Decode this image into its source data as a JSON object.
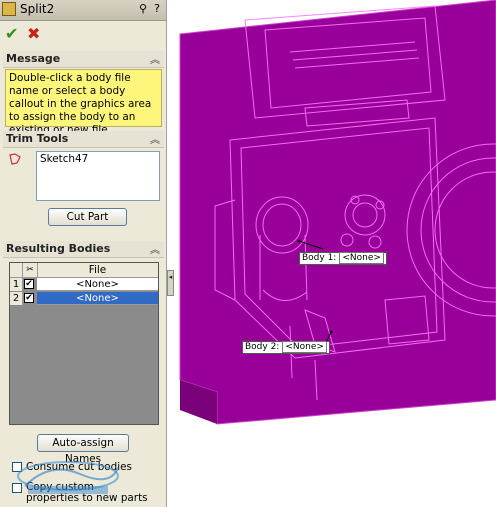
{
  "panel": {
    "title": "Split2",
    "help_icons": [
      "pushpin-icon",
      "help-icon"
    ],
    "actions": {
      "ok": "✔",
      "cancel": "✖"
    },
    "message": {
      "header": "Message",
      "text": "Double-click a body file name or select a body callout in the graphics area to assign the body to an existing or new file."
    },
    "trim_tools": {
      "header": "Trim Tools",
      "items": [
        "Sketch47"
      ],
      "button": "Cut Part"
    },
    "resulting_bodies": {
      "header": "Resulting Bodies",
      "column_file": "File",
      "rows": [
        {
          "num": "1",
          "checked": true,
          "file": "<None>",
          "selected": false
        },
        {
          "num": "2",
          "checked": true,
          "file": "<None>",
          "selected": true
        }
      ],
      "button": "Auto-assign Names",
      "options": [
        "Consume cut bodies",
        "Copy custom properties to new parts"
      ]
    }
  },
  "graphics": {
    "body_color": "#990099",
    "edge_color": "#ff66ff",
    "callouts": [
      {
        "label": "Body 1:",
        "value": "<None>"
      },
      {
        "label": "Body 2:",
        "value": "<None>"
      }
    ]
  }
}
